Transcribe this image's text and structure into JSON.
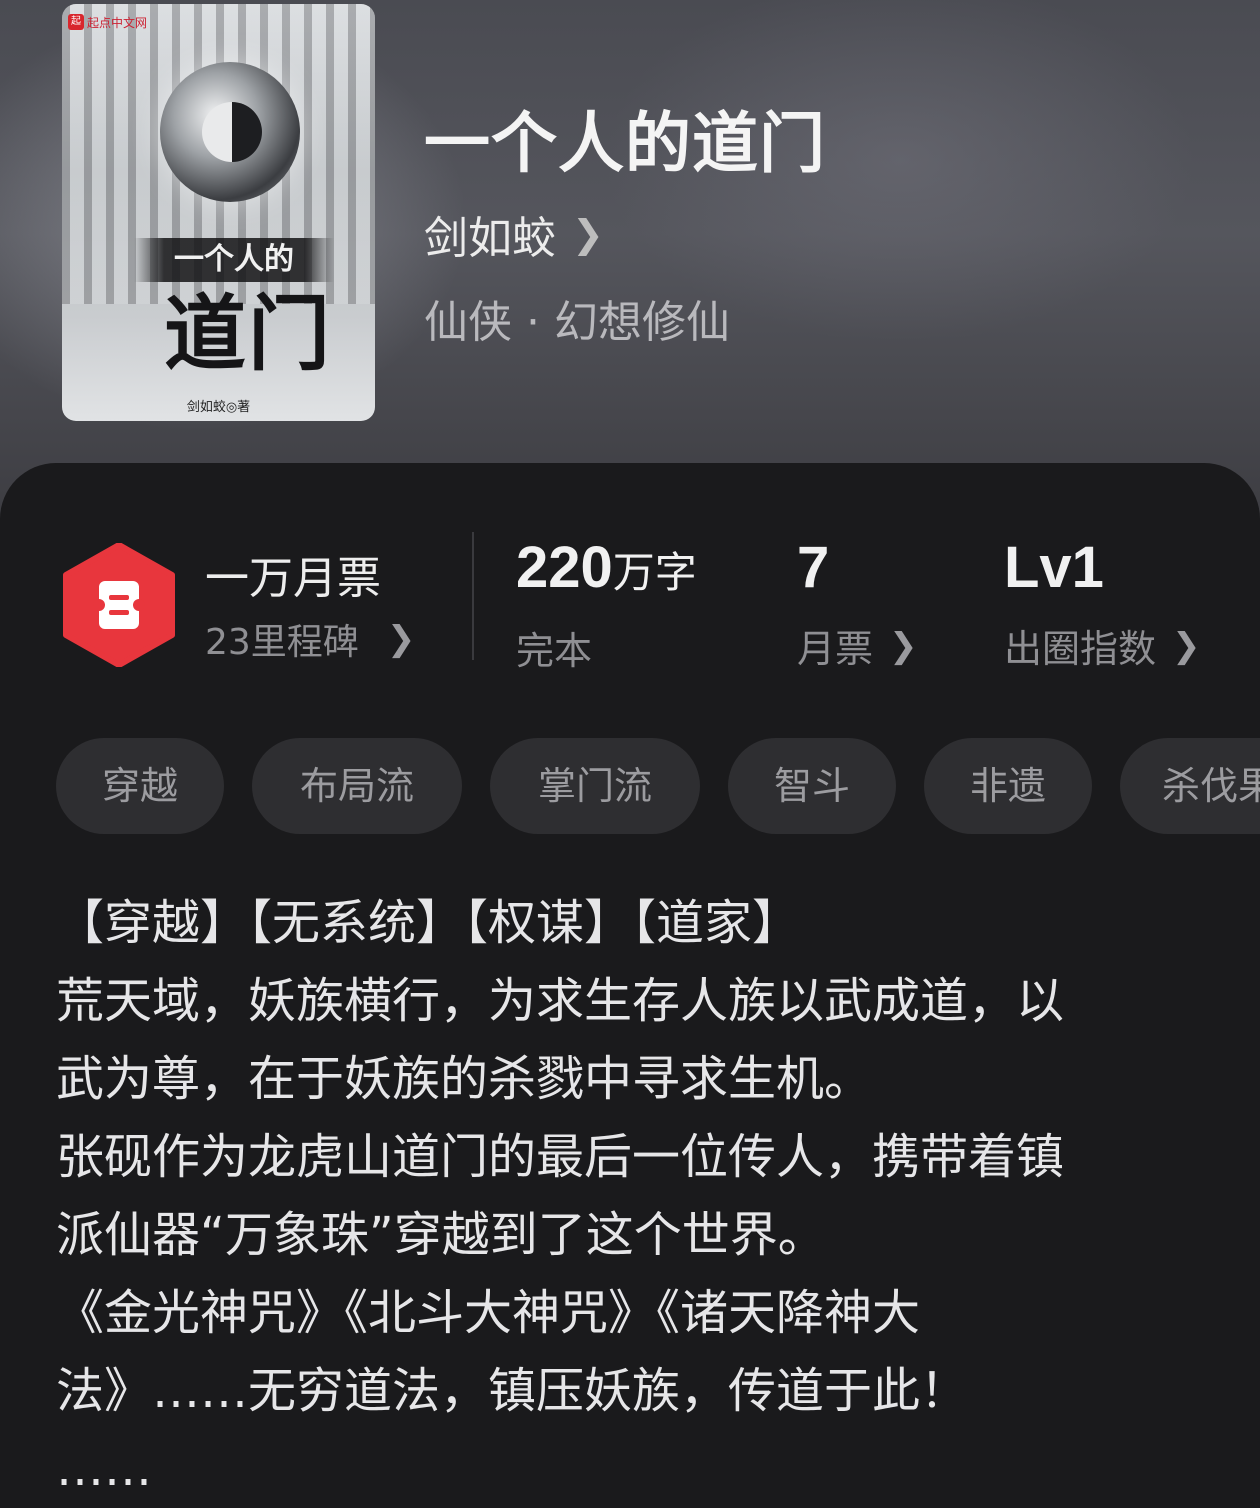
{
  "book": {
    "title": "一个人的道门",
    "author": "剑如蛟",
    "genre": "仙侠 · 幻想修仙"
  },
  "cover": {
    "publisher_logo": "起点中文网",
    "title_small": "一个人的",
    "title_big": "道门",
    "author_line": "剑如蛟◎著"
  },
  "ticket": {
    "title": "一万月票",
    "subtitle": "23里程碑",
    "badge_color": "#e8363d"
  },
  "stats": {
    "words": {
      "number": "220",
      "unit": "万字",
      "label": "完本"
    },
    "monthly": {
      "number": "7",
      "label": "月票"
    },
    "level": {
      "number": "Lv1",
      "label": "出圈指数"
    }
  },
  "tags": [
    "穿越",
    "布局流",
    "掌门流",
    "智斗",
    "非遗",
    "杀伐果断"
  ],
  "description": {
    "lines": [
      "【穿越】【无系统】【权谋】【道家】",
      "荒天域，妖族横行，为求生存人族以武成道，以",
      "武为尊，在于妖族的杀戮中寻求生机。",
      "张砚作为龙虎山道门的最后一位传人，携带着镇",
      "派仙器“万象珠”穿越到了这个世界。",
      "《金光神咒》《北斗大神咒》《诸天降神大",
      "法》……无穷道法，镇压妖族，传道于此！",
      "……"
    ]
  },
  "icons": {
    "chevron": "chevron-right-icon",
    "ticket": "ticket-icon"
  }
}
